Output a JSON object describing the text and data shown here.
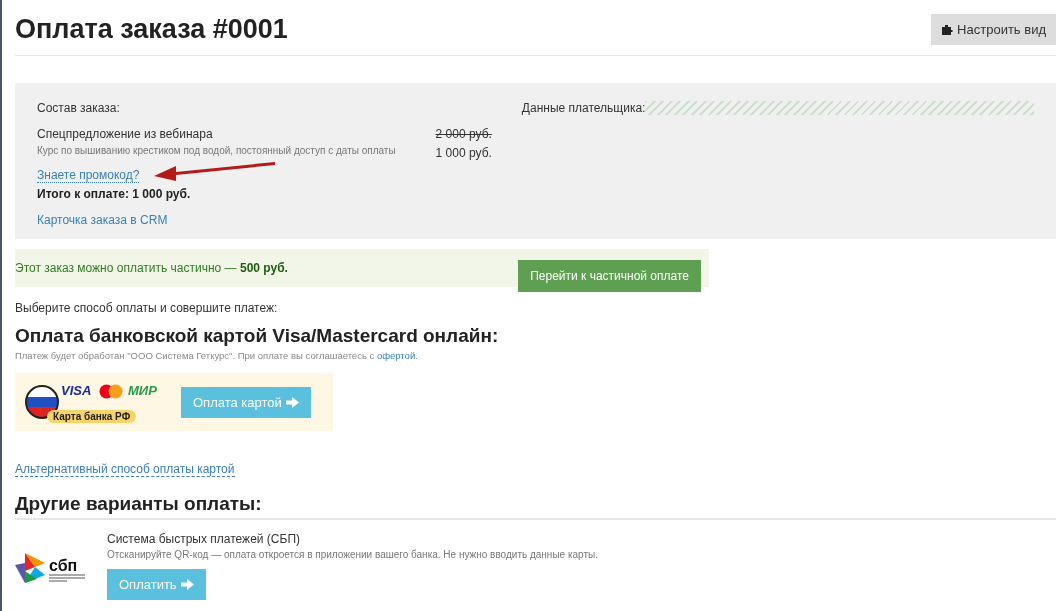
{
  "title": "Оплата заказа #0001",
  "customize_button": "Настроить вид",
  "order": {
    "heading": "Состав заказа:",
    "item_name": "Спецпредложение из вебинара",
    "item_description": "Курс по вышиванию крестиком под водой, постоянный доступ с даты оплаты",
    "old_price": "2 000 руб.",
    "price": "1 000 руб.",
    "promo_link": "Знаете промокод?",
    "total": "Итого к оплате: 1 000 руб.",
    "crm_link": "Карточка заказа в CRM"
  },
  "payer": {
    "heading": "Данные плательщика:",
    "loading": true
  },
  "partial": {
    "text": "Этот заказ можно оплатить частично — **500 руб.**",
    "button": "Перейти к частичной оплате"
  },
  "choose_text": "Выберите способ оплаты и совершите платеж:",
  "card_section": {
    "heading": "Оплата банковской картой Visa/Mastercard онлайн:",
    "note_before": "Платеж будет обработан \"ООО Система Геткурс\". При оплате вы соглашаетесь с",
    "note_link": "офертой",
    "note_after": ".",
    "logo_visa": "VISA",
    "logo_mir": "МИР",
    "logo_caption": "Карта банка РФ",
    "button": "Оплата картой"
  },
  "alt_link": "Альтернативный способ оплаты картой",
  "other_heading": "Другие варианты оплаты:",
  "other_methods": [
    {
      "logo_text": "сбп",
      "name": "Система быстрых платежей (СБП)",
      "description": "Отсканируйте QR-код — оплата откроется в приложении вашего банка. Не нужно вводить данные карты.",
      "button": "Оплатить"
    }
  ]
}
